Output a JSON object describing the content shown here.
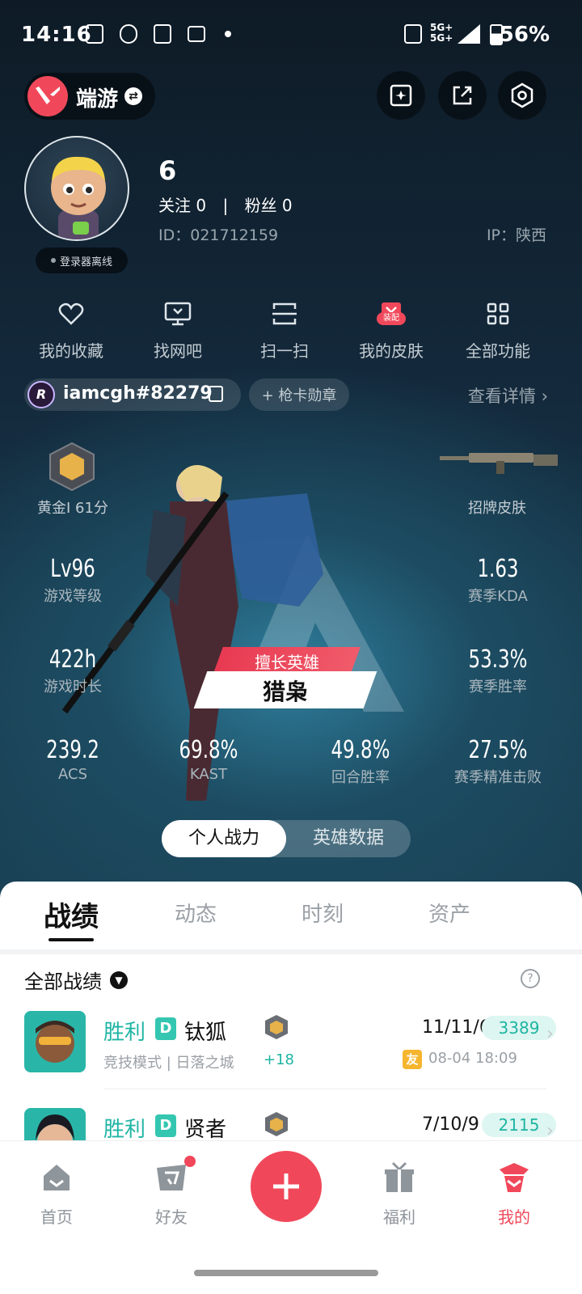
{
  "status_bar": {
    "time": "14:16",
    "network_top": "5G+",
    "network_bottom": "5G+",
    "battery": "56%"
  },
  "header": {
    "app_name": "端游",
    "swap_icon": "swap-icon",
    "buttons": [
      "edit-card-icon",
      "share-icon",
      "settings-hex-icon"
    ]
  },
  "profile": {
    "name": "6",
    "follow_label": "关注 0",
    "fans_label": "粉丝 0",
    "divider": "|",
    "id_label": "ID：021712159",
    "ip_label": "IP：陕西",
    "login_status": "登录器离线"
  },
  "functions": [
    {
      "label": "我的收藏",
      "icon": "heart-icon"
    },
    {
      "label": "找网吧",
      "icon": "monitor-icon"
    },
    {
      "label": "扫一扫",
      "icon": "scan-icon"
    },
    {
      "label": "我的皮肤",
      "icon": "skin-icon",
      "badge": "装配"
    },
    {
      "label": "全部功能",
      "icon": "grid-icon"
    }
  ],
  "game_tag": {
    "riot_id": "iamcgh#82279",
    "medal_label": "+ 枪卡勋章",
    "detail_label": "查看详情 ›"
  },
  "rank": {
    "label": "黄金I 61分",
    "skin_label": "招牌皮肤"
  },
  "stats": {
    "level": {
      "value": "Lv96",
      "label": "游戏等级"
    },
    "kda": {
      "value": "1.63",
      "label": "赛季KDA"
    },
    "hours": {
      "value": "422h",
      "label": "游戏时长"
    },
    "winrate": {
      "value": "53.3%",
      "label": "赛季胜率"
    },
    "acs": {
      "value": "239.2",
      "label": "ACS"
    },
    "kast": {
      "value": "69.8%",
      "label": "KAST"
    },
    "round_win": {
      "value": "49.8%",
      "label": "回合胜率"
    },
    "headshot": {
      "value": "27.5%",
      "label": "赛季精准击败"
    }
  },
  "hero": {
    "tag": "擅长英雄",
    "name": "猎枭"
  },
  "toggle": {
    "active": "个人战力",
    "inactive": "英雄数据"
  },
  "tabs": [
    "战绩",
    "动态",
    "时刻",
    "资产"
  ],
  "records": {
    "filter_label": "全部战绩",
    "help": "?",
    "items": [
      {
        "result": "胜利",
        "mode_letter": "D",
        "agent": "钛狐",
        "sub": "竞技模式 | 日落之城",
        "points": "+18",
        "kda": "11/11/6",
        "score": "3389",
        "friend_badge": "友",
        "time": "08-04 18:09"
      },
      {
        "result": "胜利",
        "mode_letter": "D",
        "agent": "贤者",
        "sub": "",
        "points": "",
        "kda": "7/10/9",
        "score": "2115",
        "friend_badge": "",
        "time": ""
      }
    ]
  },
  "nav": [
    {
      "label": "首页",
      "icon": "home-icon"
    },
    {
      "label": "好友",
      "icon": "friends-icon"
    },
    {
      "label": "",
      "icon": "plus-icon"
    },
    {
      "label": "福利",
      "icon": "gift-icon"
    },
    {
      "label": "我的",
      "icon": "profile-icon"
    }
  ],
  "colors": {
    "accent": "#f0485a",
    "win": "#1fb5a3",
    "gold": "#f5b52e"
  }
}
